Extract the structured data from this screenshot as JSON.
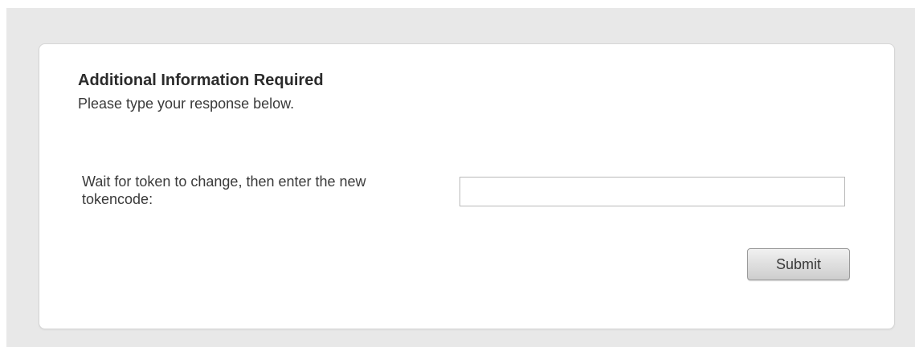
{
  "dialog": {
    "title": "Additional Information Required",
    "subtitle": "Please type your response below."
  },
  "form": {
    "field_label": "Wait for token to change, then enter the new tokencode:",
    "field_value": "",
    "submit_label": "Submit"
  },
  "colors": {
    "background": "#e8e8e8",
    "panel": "#ffffff",
    "text": "#3a3a3a"
  }
}
